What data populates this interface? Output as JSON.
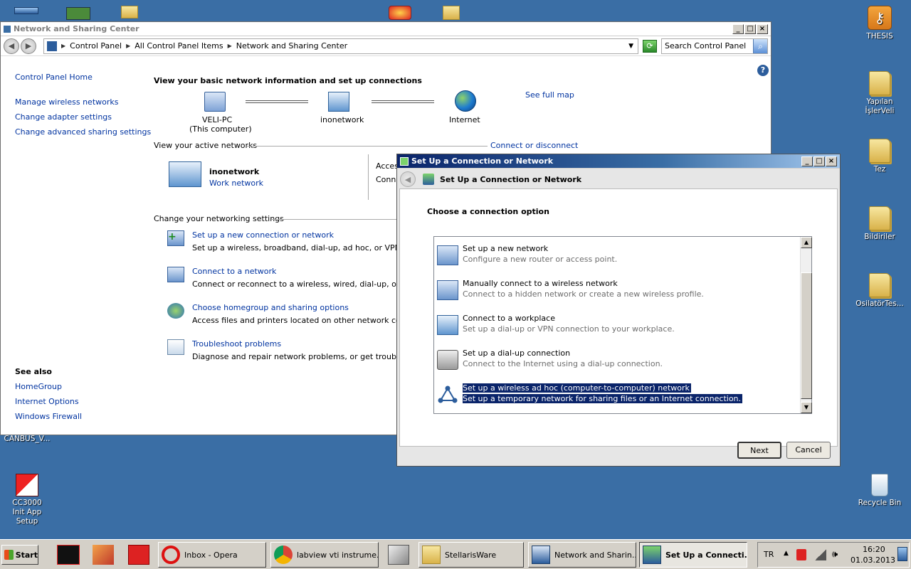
{
  "desktop": {
    "icons": [
      {
        "label": "THESIS"
      },
      {
        "label": "Yapılan İşlerVeli"
      },
      {
        "label": "Tez"
      },
      {
        "label": "Bildiriler"
      },
      {
        "label": "OsilatörTes..."
      },
      {
        "label": "Recycle Bin"
      },
      {
        "label": "CC3000 Init App Setup"
      },
      {
        "label": "CANBUS_V..."
      }
    ]
  },
  "nsc": {
    "title": "Network and Sharing Center",
    "breadcrumb": [
      "Control Panel",
      "All Control Panel Items",
      "Network and Sharing Center"
    ],
    "search_placeholder": "Search Control Panel",
    "left": {
      "home": "Control Panel Home",
      "links": [
        "Manage wireless networks",
        "Change adapter settings",
        "Change advanced sharing settings"
      ],
      "see_also_title": "See also",
      "see_also": [
        "HomeGroup",
        "Internet Options",
        "Windows Firewall"
      ]
    },
    "main": {
      "heading": "View your basic network information and set up connections",
      "see_full_map": "See full map",
      "map": [
        {
          "name": "VELI-PC",
          "sub": "(This computer)"
        },
        {
          "name": "inonetwork",
          "sub": ""
        },
        {
          "name": "Internet",
          "sub": ""
        }
      ],
      "active_title": "View your active networks",
      "connect_disconnect": "Connect or disconnect",
      "active_network": {
        "name": "inonetwork",
        "type": "Work network",
        "access": "Access",
        "connections": "Conne"
      },
      "settings_title": "Change your networking settings",
      "tasks": [
        {
          "link": "Set up a new connection or network",
          "desc": "Set up a wireless, broadband, dial-up, ad hoc, or VPN conne"
        },
        {
          "link": "Connect to a network",
          "desc": "Connect or reconnect to a wireless, wired, dial-up, or VPN n"
        },
        {
          "link": "Choose homegroup and sharing options",
          "desc": "Access files and printers located on other network computer"
        },
        {
          "link": "Troubleshoot problems",
          "desc": "Diagnose and repair network problems, or get troubleshooti"
        }
      ]
    }
  },
  "dialog": {
    "title": "Set Up a Connection or Network",
    "header": "Set Up a Connection or Network",
    "prompt": "Choose a connection option",
    "options": [
      {
        "title": "Set up a new network",
        "desc": "Configure a new router or access point."
      },
      {
        "title": "Manually connect to a wireless network",
        "desc": "Connect to a hidden network or create a new wireless profile."
      },
      {
        "title": "Connect to a workplace",
        "desc": "Set up a dial-up or VPN connection to your workplace."
      },
      {
        "title": "Set up a dial-up connection",
        "desc": "Connect to the Internet using a dial-up connection."
      },
      {
        "title": "Set up a wireless ad hoc (computer-to-computer) network",
        "desc": "Set up a temporary network for sharing files or an Internet connection."
      }
    ],
    "next": "Next",
    "cancel": "Cancel"
  },
  "taskbar": {
    "start": "Start",
    "items": [
      {
        "label": "Inbox - Opera"
      },
      {
        "label": "labview vti instrume..."
      },
      {
        "label": "StellarisWare"
      },
      {
        "label": "Network and Sharin..."
      },
      {
        "label": "Set Up a Connecti..."
      }
    ],
    "tray": {
      "lang": "TR",
      "time": "16:20",
      "date": "01.03.2013"
    }
  }
}
